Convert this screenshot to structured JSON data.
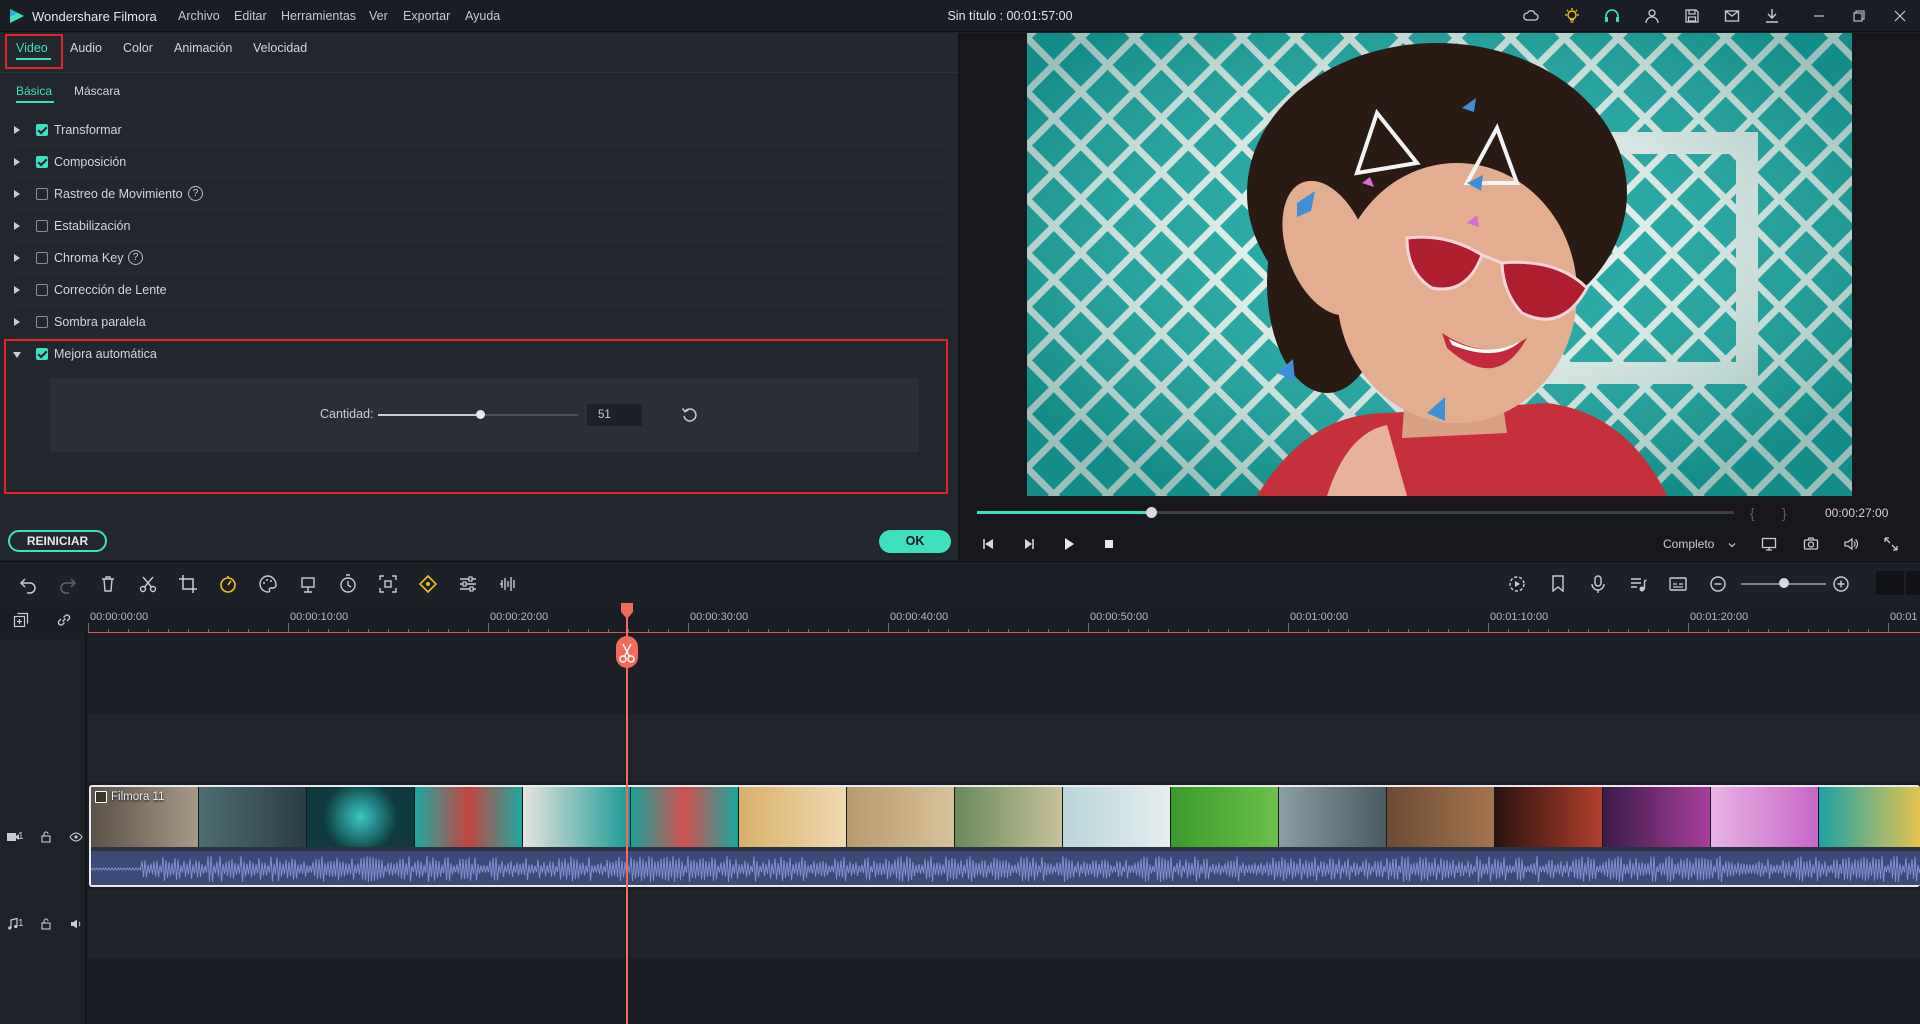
{
  "window": {
    "app_name": "Wondershare Filmora",
    "doc_title": "Sin título : 00:01:57:00",
    "menu": [
      "Archivo",
      "Editar",
      "Herramientas",
      "Ver",
      "Exportar",
      "Ayuda"
    ],
    "title_icons": [
      "cloud-icon",
      "bulb-icon",
      "headset-icon",
      "account-icon",
      "save-icon",
      "mail-icon",
      "download-icon",
      "minimize-icon",
      "restore-icon",
      "close-icon"
    ],
    "accent": "#3fe0c0",
    "highlight": "#e0262a"
  },
  "edit_panel": {
    "tabs": [
      "Video",
      "Audio",
      "Color",
      "Animación",
      "Velocidad"
    ],
    "active_tab": "Video",
    "subtabs": [
      "Básica",
      "Máscara"
    ],
    "active_subtab": "Básica",
    "rows": [
      {
        "label": "Transformar",
        "checked": true,
        "expanded": false
      },
      {
        "label": "Composición",
        "checked": true,
        "expanded": false
      },
      {
        "label": "Rastreo de Movimiento",
        "checked": false,
        "expanded": false,
        "help": true
      },
      {
        "label": "Estabilización",
        "checked": false,
        "expanded": false
      },
      {
        "label": "Chroma Key",
        "checked": false,
        "expanded": false,
        "help": true
      },
      {
        "label": "Corrección de Lente",
        "checked": false,
        "expanded": false
      },
      {
        "label": "Sombra paralela",
        "checked": false,
        "expanded": false
      },
      {
        "label": "Mejora automática",
        "checked": true,
        "expanded": true
      }
    ],
    "amount": {
      "label": "Cantidad:",
      "value": "51",
      "level": 0.51
    },
    "reset_button": "REINICIAR",
    "ok_button": "OK"
  },
  "preview": {
    "timecode": "00:00:27:00",
    "bracket_in": "{",
    "bracket_out": "}",
    "progress": 0.23,
    "quality": "Completo",
    "controls": [
      "prev-frame-icon",
      "play-slow-icon",
      "play-icon",
      "stop-icon"
    ]
  },
  "toolbar": {
    "left_icons": [
      "undo-icon",
      "redo-icon",
      "delete-icon",
      "cut-icon",
      "crop-icon",
      "speed-icon",
      "color-icon",
      "transform-icon",
      "duration-icon",
      "fit-icon",
      "keyframe-icon",
      "adjust-icon",
      "audio-split-icon"
    ],
    "right_icons": [
      "render-icon",
      "marker-icon",
      "mic-icon",
      "audio-mixer-icon",
      "subtitle-icon",
      "zoom-out-icon",
      "zoom-in-icon"
    ],
    "zoom_level": 0.5
  },
  "timeline": {
    "ruler_labels": [
      "00:00:00:00",
      "00:00:10:00",
      "00:00:20:00",
      "00:00:30:00",
      "00:00:40:00",
      "00:00:50:00",
      "00:01:00:00",
      "00:01:10:00",
      "00:01:20:00",
      "00:01"
    ],
    "playhead_time": "00:00:27:00",
    "clip_name": "Filmora 11",
    "video_track_label": "1",
    "audio_track_label": "1"
  }
}
